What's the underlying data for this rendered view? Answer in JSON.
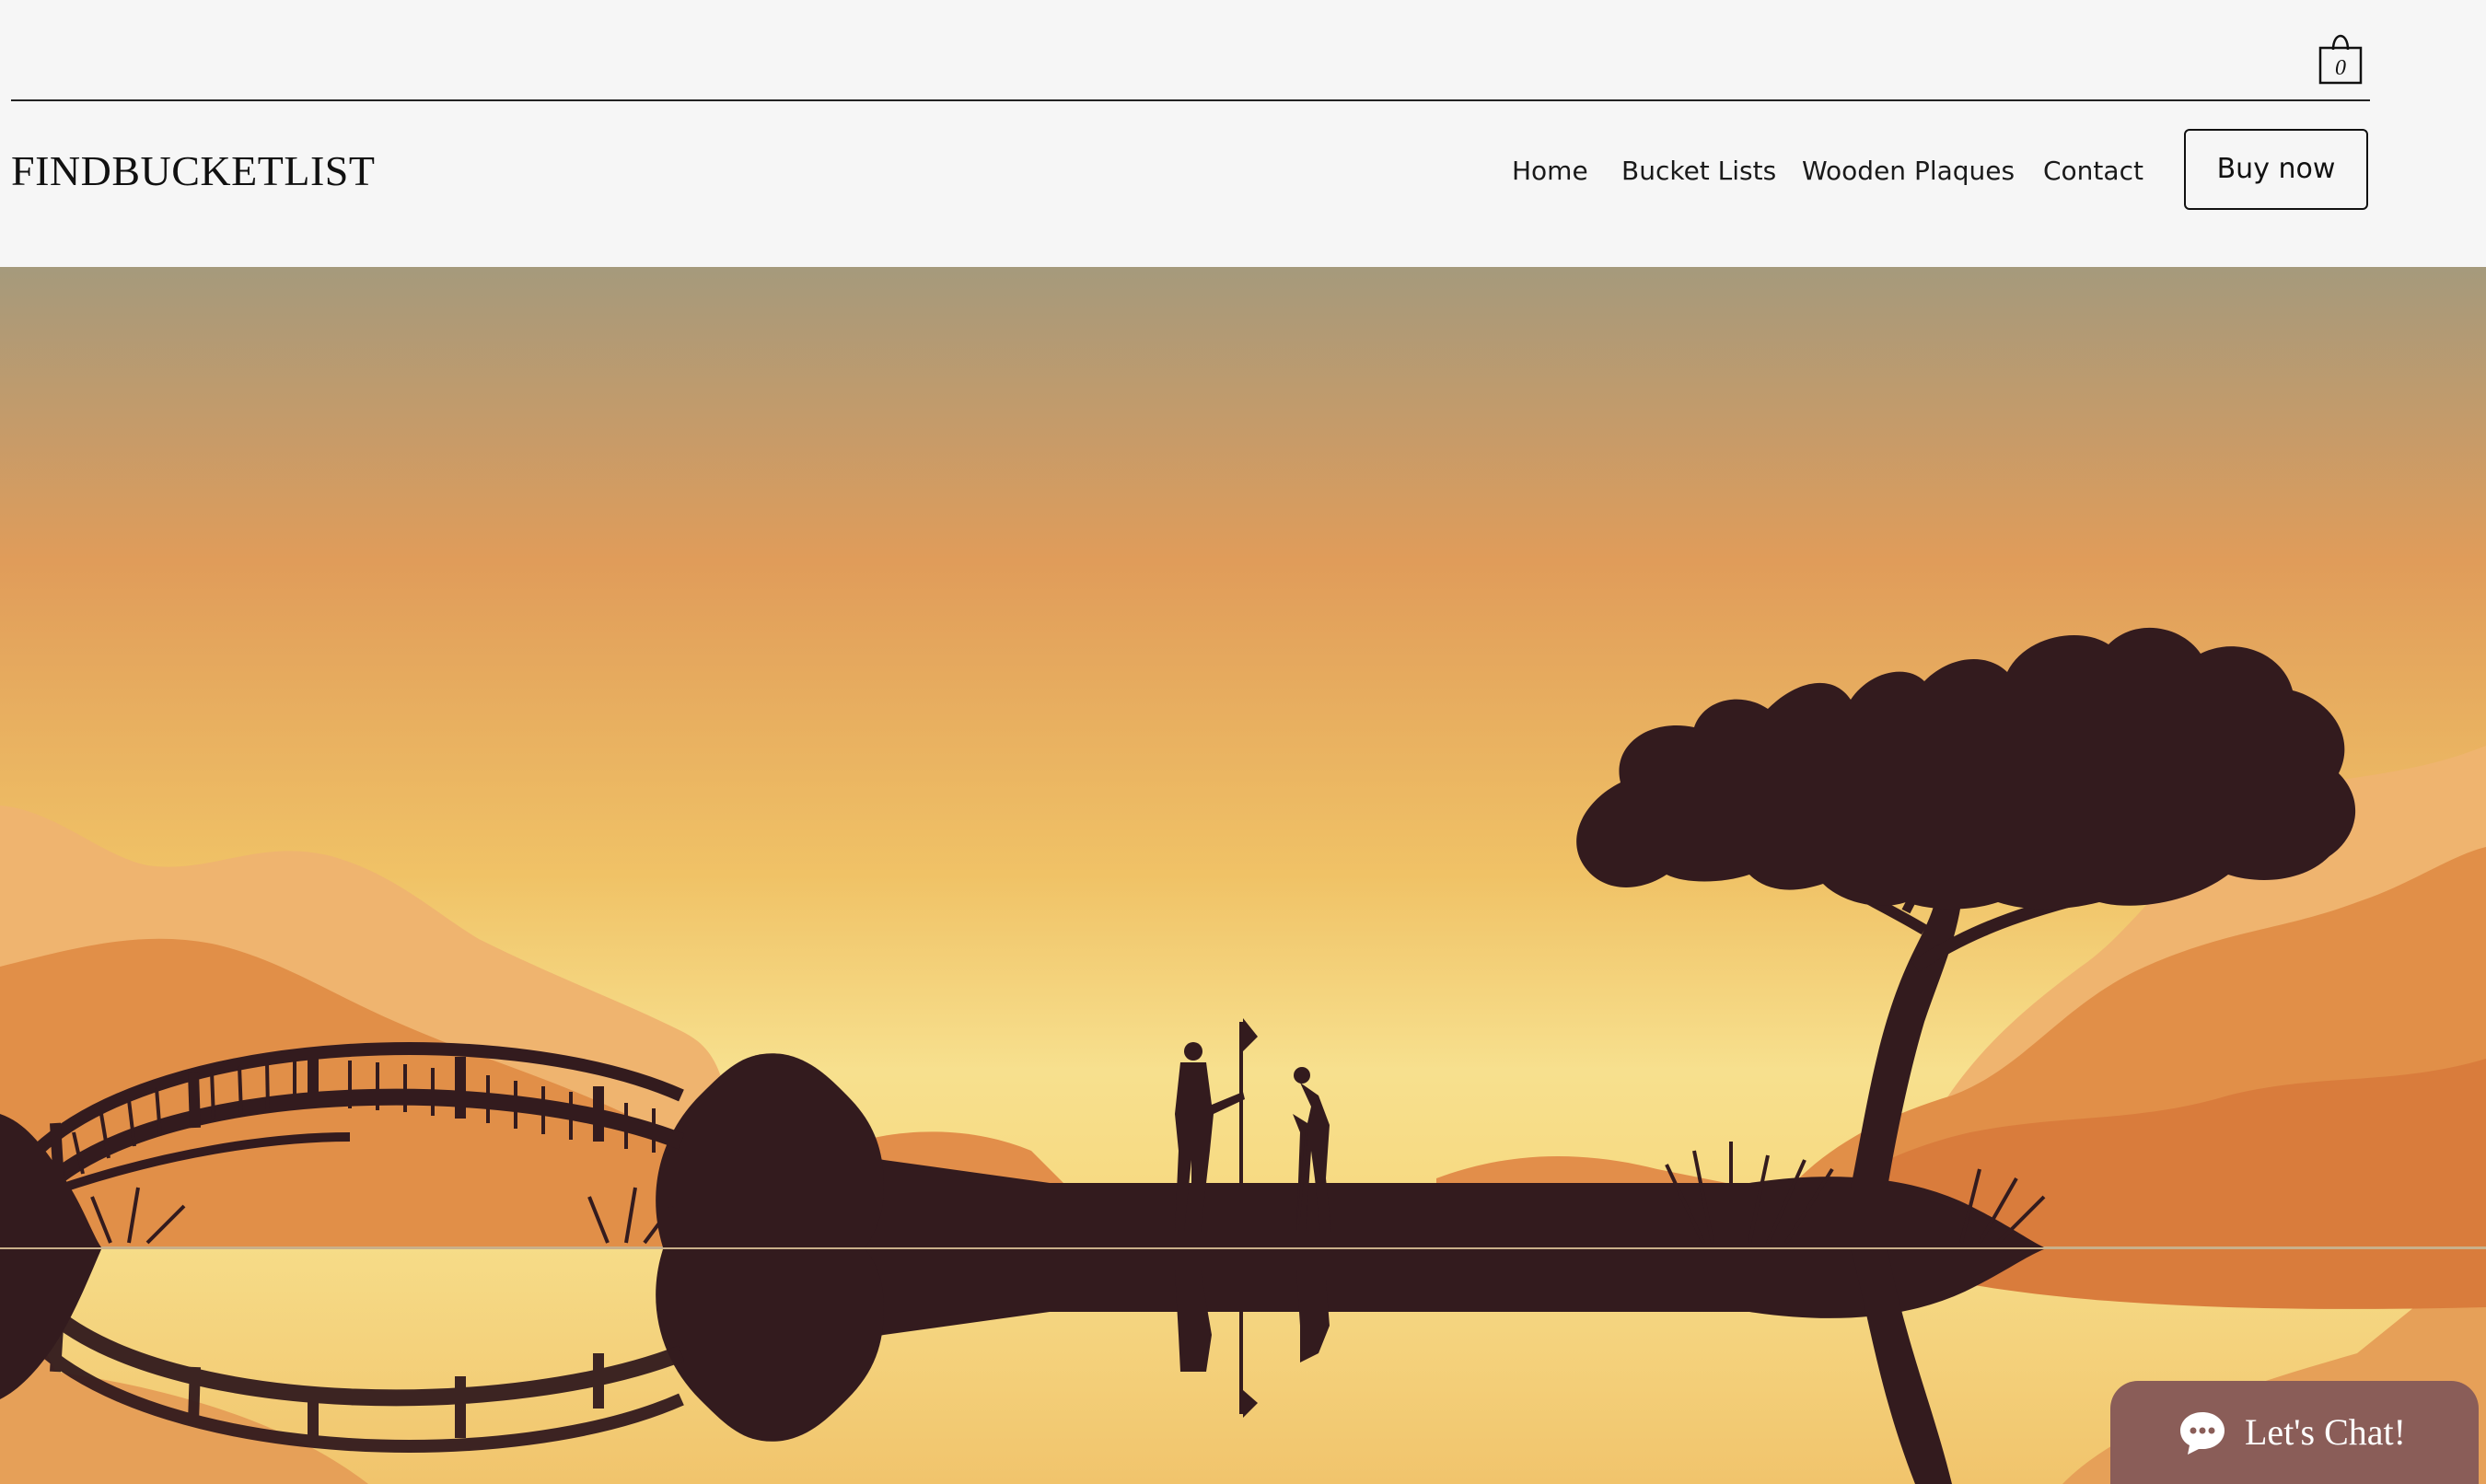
{
  "header": {
    "logo": "FINDBUCKETLIST",
    "cart_count": "0",
    "nav": [
      {
        "label": "Home"
      },
      {
        "label": "Bucket Lists"
      },
      {
        "label": "Wooden Plaques"
      },
      {
        "label": "Contact"
      }
    ],
    "buy_label": "Buy now"
  },
  "hero": {
    "scene": "golf-sunset-silhouette",
    "colors": {
      "sky_top": "#a59a7c",
      "sky_mid": "#e09c5a",
      "sky_low": "#f4d27a",
      "silhouette": "#331b1e",
      "hills_light": "#efb46f",
      "hills_mid": "#e18f48"
    }
  },
  "chat": {
    "label": "Let's Chat!",
    "icon": "chat-bubble-icon",
    "color": "#8a5d58"
  }
}
